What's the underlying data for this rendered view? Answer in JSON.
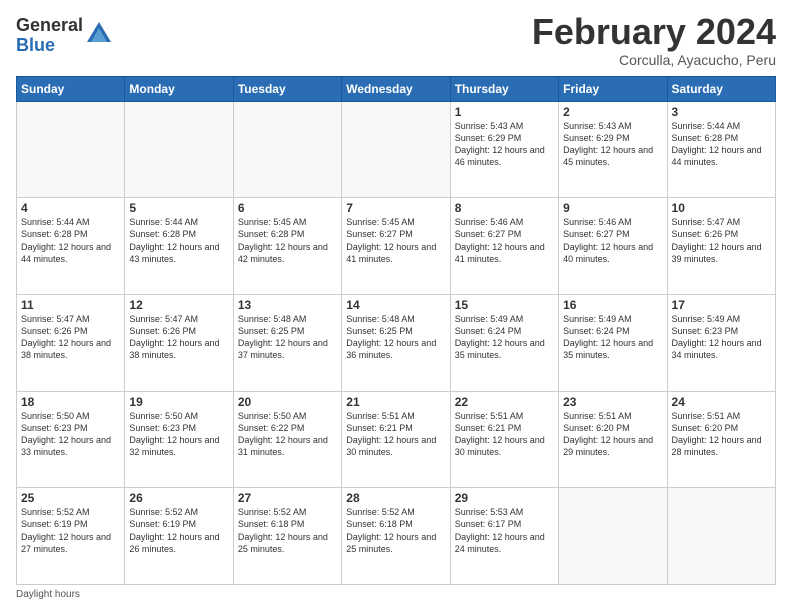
{
  "logo": {
    "general": "General",
    "blue": "Blue"
  },
  "header": {
    "month": "February 2024",
    "location": "Corculla, Ayacucho, Peru"
  },
  "weekdays": [
    "Sunday",
    "Monday",
    "Tuesday",
    "Wednesday",
    "Thursday",
    "Friday",
    "Saturday"
  ],
  "weeks": [
    [
      {
        "day": "",
        "info": ""
      },
      {
        "day": "",
        "info": ""
      },
      {
        "day": "",
        "info": ""
      },
      {
        "day": "",
        "info": ""
      },
      {
        "day": "1",
        "info": "Sunrise: 5:43 AM\nSunset: 6:29 PM\nDaylight: 12 hours\nand 46 minutes."
      },
      {
        "day": "2",
        "info": "Sunrise: 5:43 AM\nSunset: 6:29 PM\nDaylight: 12 hours\nand 45 minutes."
      },
      {
        "day": "3",
        "info": "Sunrise: 5:44 AM\nSunset: 6:28 PM\nDaylight: 12 hours\nand 44 minutes."
      }
    ],
    [
      {
        "day": "4",
        "info": "Sunrise: 5:44 AM\nSunset: 6:28 PM\nDaylight: 12 hours\nand 44 minutes."
      },
      {
        "day": "5",
        "info": "Sunrise: 5:44 AM\nSunset: 6:28 PM\nDaylight: 12 hours\nand 43 minutes."
      },
      {
        "day": "6",
        "info": "Sunrise: 5:45 AM\nSunset: 6:28 PM\nDaylight: 12 hours\nand 42 minutes."
      },
      {
        "day": "7",
        "info": "Sunrise: 5:45 AM\nSunset: 6:27 PM\nDaylight: 12 hours\nand 41 minutes."
      },
      {
        "day": "8",
        "info": "Sunrise: 5:46 AM\nSunset: 6:27 PM\nDaylight: 12 hours\nand 41 minutes."
      },
      {
        "day": "9",
        "info": "Sunrise: 5:46 AM\nSunset: 6:27 PM\nDaylight: 12 hours\nand 40 minutes."
      },
      {
        "day": "10",
        "info": "Sunrise: 5:47 AM\nSunset: 6:26 PM\nDaylight: 12 hours\nand 39 minutes."
      }
    ],
    [
      {
        "day": "11",
        "info": "Sunrise: 5:47 AM\nSunset: 6:26 PM\nDaylight: 12 hours\nand 38 minutes."
      },
      {
        "day": "12",
        "info": "Sunrise: 5:47 AM\nSunset: 6:26 PM\nDaylight: 12 hours\nand 38 minutes."
      },
      {
        "day": "13",
        "info": "Sunrise: 5:48 AM\nSunset: 6:25 PM\nDaylight: 12 hours\nand 37 minutes."
      },
      {
        "day": "14",
        "info": "Sunrise: 5:48 AM\nSunset: 6:25 PM\nDaylight: 12 hours\nand 36 minutes."
      },
      {
        "day": "15",
        "info": "Sunrise: 5:49 AM\nSunset: 6:24 PM\nDaylight: 12 hours\nand 35 minutes."
      },
      {
        "day": "16",
        "info": "Sunrise: 5:49 AM\nSunset: 6:24 PM\nDaylight: 12 hours\nand 35 minutes."
      },
      {
        "day": "17",
        "info": "Sunrise: 5:49 AM\nSunset: 6:23 PM\nDaylight: 12 hours\nand 34 minutes."
      }
    ],
    [
      {
        "day": "18",
        "info": "Sunrise: 5:50 AM\nSunset: 6:23 PM\nDaylight: 12 hours\nand 33 minutes."
      },
      {
        "day": "19",
        "info": "Sunrise: 5:50 AM\nSunset: 6:23 PM\nDaylight: 12 hours\nand 32 minutes."
      },
      {
        "day": "20",
        "info": "Sunrise: 5:50 AM\nSunset: 6:22 PM\nDaylight: 12 hours\nand 31 minutes."
      },
      {
        "day": "21",
        "info": "Sunrise: 5:51 AM\nSunset: 6:21 PM\nDaylight: 12 hours\nand 30 minutes."
      },
      {
        "day": "22",
        "info": "Sunrise: 5:51 AM\nSunset: 6:21 PM\nDaylight: 12 hours\nand 30 minutes."
      },
      {
        "day": "23",
        "info": "Sunrise: 5:51 AM\nSunset: 6:20 PM\nDaylight: 12 hours\nand 29 minutes."
      },
      {
        "day": "24",
        "info": "Sunrise: 5:51 AM\nSunset: 6:20 PM\nDaylight: 12 hours\nand 28 minutes."
      }
    ],
    [
      {
        "day": "25",
        "info": "Sunrise: 5:52 AM\nSunset: 6:19 PM\nDaylight: 12 hours\nand 27 minutes."
      },
      {
        "day": "26",
        "info": "Sunrise: 5:52 AM\nSunset: 6:19 PM\nDaylight: 12 hours\nand 26 minutes."
      },
      {
        "day": "27",
        "info": "Sunrise: 5:52 AM\nSunset: 6:18 PM\nDaylight: 12 hours\nand 25 minutes."
      },
      {
        "day": "28",
        "info": "Sunrise: 5:52 AM\nSunset: 6:18 PM\nDaylight: 12 hours\nand 25 minutes."
      },
      {
        "day": "29",
        "info": "Sunrise: 5:53 AM\nSunset: 6:17 PM\nDaylight: 12 hours\nand 24 minutes."
      },
      {
        "day": "",
        "info": ""
      },
      {
        "day": "",
        "info": ""
      }
    ]
  ],
  "footer": {
    "daylight_hours": "Daylight hours"
  }
}
